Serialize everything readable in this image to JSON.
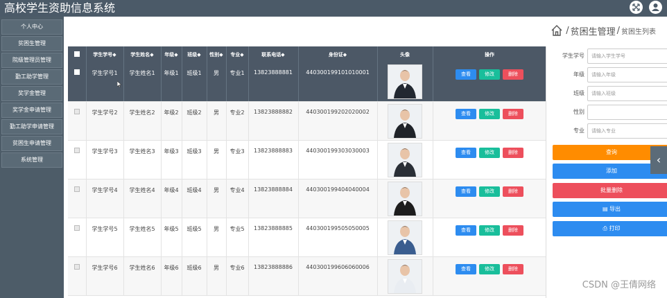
{
  "header": {
    "title": "高校学生资助信息系统",
    "fullscreen_icon": "expand-icon",
    "user_icon": "user-icon"
  },
  "sidebar": {
    "items": [
      {
        "label": "个人中心"
      },
      {
        "label": "贫困生管理"
      },
      {
        "label": "院级管理员管理"
      },
      {
        "label": "勤工助学管理"
      },
      {
        "label": "奖学金管理"
      },
      {
        "label": "奖学金申请管理"
      },
      {
        "label": "勤工助学申请管理"
      },
      {
        "label": "贫困生申请管理"
      },
      {
        "label": "系统管理"
      }
    ]
  },
  "breadcrumb": {
    "home_icon": "home-icon",
    "section": "贫困生管理",
    "page": "贫困生列表",
    "separator": "/"
  },
  "table": {
    "headers": [
      "学生学号◆",
      "学生姓名◆",
      "年级◆",
      "班级◆",
      "性别◆",
      "专业◆",
      "联系电话◆",
      "身份证◆",
      "头像",
      "操作"
    ],
    "rows": [
      {
        "sid": "学生学号1",
        "name": "学生姓名1",
        "grade": "年级1",
        "cls": "班级1",
        "gender": "男",
        "major": "专业1",
        "phone": "13823888881",
        "idcard": "440300199101010001"
      },
      {
        "sid": "学生学号2",
        "name": "学生姓名2",
        "grade": "年级2",
        "cls": "班级2",
        "gender": "男",
        "major": "专业2",
        "phone": "13823888882",
        "idcard": "440300199202020002"
      },
      {
        "sid": "学生学号3",
        "name": "学生姓名3",
        "grade": "年级3",
        "cls": "班级3",
        "gender": "男",
        "major": "专业3",
        "phone": "13823888883",
        "idcard": "440300199303030003"
      },
      {
        "sid": "学生学号4",
        "name": "学生姓名4",
        "grade": "年级4",
        "cls": "班级4",
        "gender": "男",
        "major": "专业4",
        "phone": "13823888884",
        "idcard": "440300199404040004"
      },
      {
        "sid": "学生学号5",
        "name": "学生姓名5",
        "grade": "年级5",
        "cls": "班级5",
        "gender": "男",
        "major": "专业5",
        "phone": "13823888885",
        "idcard": "440300199505050005"
      },
      {
        "sid": "学生学号6",
        "name": "学生姓名6",
        "grade": "年级6",
        "cls": "班级6",
        "gender": "男",
        "major": "专业6",
        "phone": "13823888886",
        "idcard": "440300199606060006"
      }
    ],
    "buttons": {
      "view": "查看",
      "edit": "修改",
      "delete": "删除"
    }
  },
  "search": {
    "sid_label": "学生学号",
    "sid_placeholder": "请输入学生学号",
    "grade_label": "年级",
    "grade_placeholder": "请输入年级",
    "class_label": "班级",
    "class_placeholder": "请输入班级",
    "gender_label": "性别",
    "gender_value": "",
    "major_label": "专业",
    "major_placeholder": "请输入专业"
  },
  "actions": {
    "query": "查询",
    "add": "添加",
    "bulk_delete": "批量删除",
    "export": "导出",
    "print": "打印"
  },
  "watermark": "CSDN @王倩网络",
  "colors": {
    "header_bg": "#4b5a68",
    "primary": "#2d8cf0",
    "teal": "#19be9b",
    "danger": "#ed4f5c",
    "warning": "#ff8c00"
  }
}
